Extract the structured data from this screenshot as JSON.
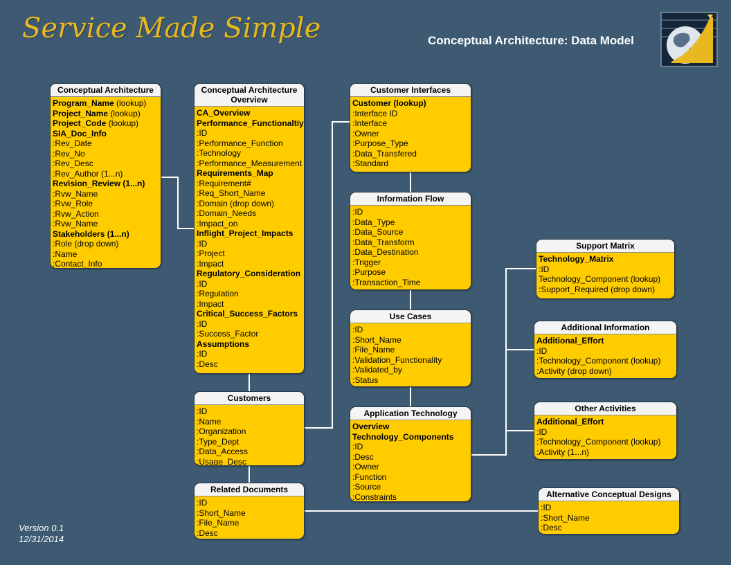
{
  "header": {
    "logo_text": "Service Made Simple",
    "title": "Conceptual Architecture: Data Model",
    "emblem_icon": "globe-growth-chart-icon"
  },
  "footer": {
    "version": "Version 0.1",
    "date": "12/31/2014"
  },
  "colors": {
    "background": "#3d5a72",
    "entity_body": "#ffcc00",
    "entity_header": "#f4f4f4",
    "logo": "#e8b820",
    "connector": "#ffffff"
  },
  "entities": {
    "conceptual_architecture": {
      "title": "Conceptual Architecture",
      "fields": [
        {
          "text": "Program_Name",
          "suffix": " (lookup)",
          "bold": true
        },
        {
          "text": "Project_Name",
          "suffix": " (lookup)",
          "bold": true
        },
        {
          "text": "Project_Code",
          "suffix": " (lookup)",
          "bold": true
        },
        {
          "text": "SIA_Doc_Info",
          "bold": true
        },
        {
          "text": ":Rev_Date"
        },
        {
          "text": ":Rev_No"
        },
        {
          "text": ":Rev_Desc"
        },
        {
          "text": ":Rev_Author (1...n)"
        },
        {
          "text": "Revision_Review (1...n)",
          "bold": true
        },
        {
          "text": ":Rvw_Name"
        },
        {
          "text": ":Rvw_Role"
        },
        {
          "text": ":Rvw_Action"
        },
        {
          "text": ":Rvw_Name"
        },
        {
          "text": "Stakeholders (1...n)",
          "bold": true
        },
        {
          "text": ":Role (drop down)"
        },
        {
          "text": ":Name"
        },
        {
          "text": ":Contact_Info"
        }
      ]
    },
    "ca_overview": {
      "title": "Conceptual Architecture Overview",
      "fields": [
        {
          "text": "CA_Overview",
          "bold": true
        },
        {
          "text": "Performance_Functionaltiy",
          "bold": true
        },
        {
          "text": ":ID"
        },
        {
          "text": ":Performance_Function"
        },
        {
          "text": ":Technology"
        },
        {
          "text": ":Performance_Measurement"
        },
        {
          "text": "Requirements_Map",
          "bold": true
        },
        {
          "text": ":Requirement#"
        },
        {
          "text": ":Req_Short_Name"
        },
        {
          "text": ":Domain (drop down)"
        },
        {
          "text": ":Domain_Needs"
        },
        {
          "text": ":Impact_on"
        },
        {
          "text": "Inflight_Project_Impacts",
          "bold": true
        },
        {
          "text": ":ID"
        },
        {
          "text": ":Project"
        },
        {
          "text": ":Impact"
        },
        {
          "text": "Regulatory_Consideration",
          "bold": true
        },
        {
          "text": ":ID"
        },
        {
          "text": ":Regulation"
        },
        {
          "text": ":Impact"
        },
        {
          "text": "Critical_Success_Factors",
          "bold": true
        },
        {
          "text": ":ID"
        },
        {
          "text": ":Success_Factor"
        },
        {
          "text": "Assumptions",
          "bold": true
        },
        {
          "text": ":ID"
        },
        {
          "text": ":Desc"
        }
      ]
    },
    "customers": {
      "title": "Customers",
      "fields": [
        {
          "text": ":ID"
        },
        {
          "text": ":Name"
        },
        {
          "text": ":Organization"
        },
        {
          "text": ":Type_Dept"
        },
        {
          "text": ":Data_Access"
        },
        {
          "text": ":Usage_Desc"
        }
      ]
    },
    "related_documents": {
      "title": "Related Documents",
      "fields": [
        {
          "text": ":ID"
        },
        {
          "text": ":Short_Name"
        },
        {
          "text": ":File_Name"
        },
        {
          "text": ":Desc"
        }
      ]
    },
    "customer_interfaces": {
      "title": "Customer Interfaces",
      "fields": [
        {
          "text": "Customer (lookup)",
          "bold": true
        },
        {
          "text": ":Interface ID"
        },
        {
          "text": ":Interface"
        },
        {
          "text": ":Owner"
        },
        {
          "text": ":Purpose_Type"
        },
        {
          "text": ":Data_Transfered"
        },
        {
          "text": ":Standard"
        }
      ]
    },
    "information_flow": {
      "title": "Information Flow",
      "fields": [
        {
          "text": ":ID"
        },
        {
          "text": ":Data_Type"
        },
        {
          "text": ":Data_Source"
        },
        {
          "text": ":Data_Transform"
        },
        {
          "text": ":Data_Destination"
        },
        {
          "text": ":Trigger"
        },
        {
          "text": ":Purpose"
        },
        {
          "text": ":Transaction_Time"
        }
      ]
    },
    "use_cases": {
      "title": "Use Cases",
      "fields": [
        {
          "text": ":ID"
        },
        {
          "text": ":Short_Name"
        },
        {
          "text": ":File_Name"
        },
        {
          "text": ":Validation_Functionality"
        },
        {
          "text": ":Validated_by"
        },
        {
          "text": ":Status"
        }
      ]
    },
    "application_technology": {
      "title": "Application Technology",
      "fields": [
        {
          "text": "Overview",
          "bold": true
        },
        {
          "text": "Technology_Components",
          "bold": true
        },
        {
          "text": ":ID"
        },
        {
          "text": ":Desc"
        },
        {
          "text": ":Owner"
        },
        {
          "text": ":Function"
        },
        {
          "text": ":Source"
        },
        {
          "text": ":Constraints"
        }
      ]
    },
    "support_matrix": {
      "title": "Support Matrix",
      "fields": [
        {
          "text": "Technology_Matrix",
          "bold": true
        },
        {
          "text": ":ID"
        },
        {
          "text": "Technology_Component (lookup)"
        },
        {
          "text": ":Support_Required (drop down)"
        }
      ]
    },
    "additional_information": {
      "title": "Additional Information",
      "fields": [
        {
          "text": "Additional_Effort",
          "bold": true
        },
        {
          "text": ":ID"
        },
        {
          "text": ":Technology_Component (lookup)"
        },
        {
          "text": ":Activity (drop down)"
        }
      ]
    },
    "other_activities": {
      "title": "Other Activities",
      "fields": [
        {
          "text": "Additional_Effort",
          "bold": true
        },
        {
          "text": ":ID"
        },
        {
          "text": ":Technology_Component (lookup)"
        },
        {
          "text": ":Activity (1...n)"
        }
      ]
    },
    "alternative_designs": {
      "title": "Alternative Conceptual Designs",
      "fields": [
        {
          "text": ":ID"
        },
        {
          "text": ":Short_Name"
        },
        {
          "text": ":Desc"
        }
      ]
    }
  },
  "connections": [
    {
      "from": "conceptual_architecture",
      "to": "ca_overview"
    },
    {
      "from": "ca_overview",
      "to": "customers"
    },
    {
      "from": "customers",
      "to": "related_documents"
    },
    {
      "from": "customers",
      "to": "customer_interfaces"
    },
    {
      "from": "customer_interfaces",
      "to": "information_flow"
    },
    {
      "from": "information_flow",
      "to": "use_cases"
    },
    {
      "from": "use_cases",
      "to": "application_technology"
    },
    {
      "from": "application_technology",
      "to": "support_matrix"
    },
    {
      "from": "application_technology",
      "to": "additional_information"
    },
    {
      "from": "application_technology",
      "to": "other_activities"
    },
    {
      "from": "related_documents",
      "to": "alternative_designs"
    }
  ]
}
